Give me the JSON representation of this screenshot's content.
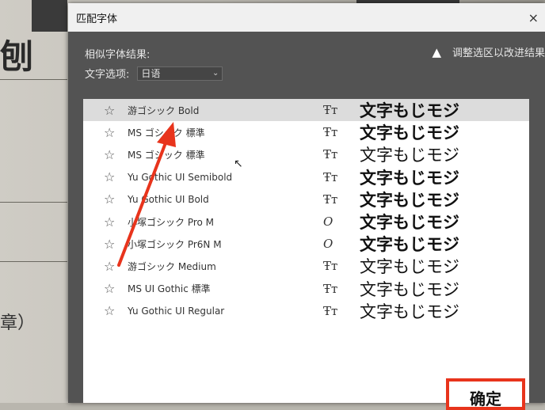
{
  "background": {
    "char_top": "刨",
    "char_bottom": "章）"
  },
  "dialog": {
    "title": "匹配字体",
    "close_icon": "×",
    "similar_results_label": "相似字体结果:",
    "text_options_label": "文字选项:",
    "language_value": "日语",
    "hint_text": "调整选区以改进结果",
    "ok_label": "确定"
  },
  "fonts": [
    {
      "name": "游ゴシック Bold",
      "type_icon": "truetype",
      "sample": "文字もじモジ",
      "bold": true
    },
    {
      "name": "MS ゴシック 標準",
      "type_icon": "truetype",
      "sample": "文字もじモジ",
      "bold": true
    },
    {
      "name": "MS ゴシック 標準",
      "type_icon": "truetype",
      "sample": "文字もじモジ",
      "bold": false
    },
    {
      "name": "Yu Gothic UI Semibold",
      "type_icon": "truetype",
      "sample": "文字もじモジ",
      "bold": true
    },
    {
      "name": "Yu Gothic UI Bold",
      "type_icon": "truetype",
      "sample": "文字もじモジ",
      "bold": true
    },
    {
      "name": "小塚ゴシック Pro M",
      "type_icon": "opentype",
      "sample": "文字もじモジ",
      "bold": true
    },
    {
      "name": "小塚ゴシック Pr6N M",
      "type_icon": "opentype",
      "sample": "文字もじモジ",
      "bold": true
    },
    {
      "name": "游ゴシック Medium",
      "type_icon": "truetype",
      "sample": "文字もじモジ",
      "bold": false
    },
    {
      "name": "MS UI Gothic 標準",
      "type_icon": "truetype",
      "sample": "文字もじモジ",
      "bold": false
    },
    {
      "name": "Yu Gothic UI Regular",
      "type_icon": "truetype",
      "sample": "文字もじモジ",
      "bold": false
    }
  ],
  "colors": {
    "accent_red": "#e8341c",
    "dialog_bg": "#535353",
    "selected_row": "#dcdcdc"
  }
}
